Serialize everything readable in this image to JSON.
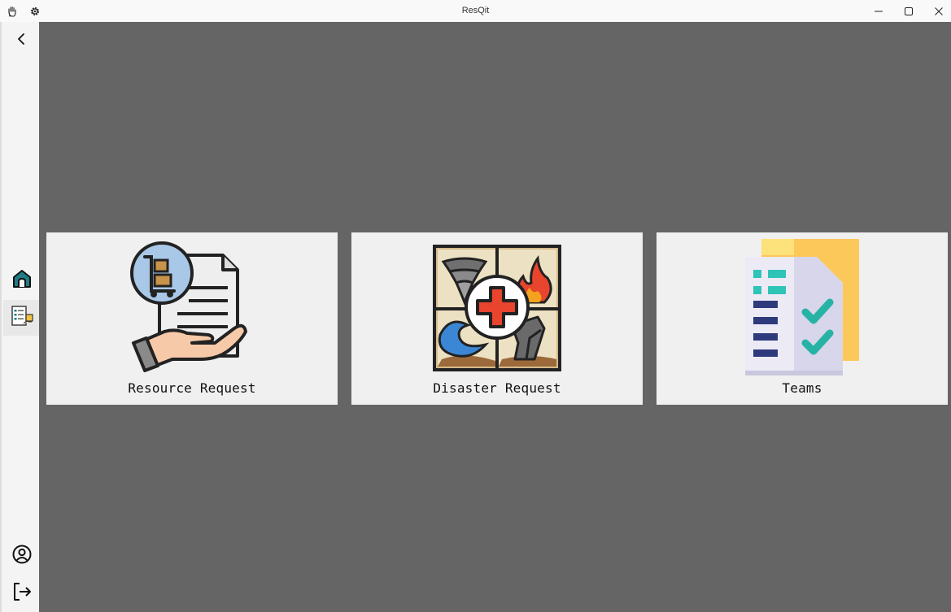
{
  "window": {
    "title": "ResQit",
    "left_icons": [
      "hand-icon",
      "settings-gear-icon"
    ],
    "controls": [
      "minimize-icon",
      "maximize-icon",
      "close-icon"
    ]
  },
  "sidebar": {
    "items": [
      {
        "name": "back",
        "icon": "chevron-left-icon"
      },
      {
        "name": "home",
        "icon": "home-icon",
        "color": "#1e7d86"
      },
      {
        "name": "requests",
        "icon": "document-list-icon",
        "selected": true
      },
      {
        "name": "profile",
        "icon": "user-circle-icon"
      },
      {
        "name": "logout",
        "icon": "logout-arrow-icon"
      }
    ]
  },
  "main": {
    "background": "#656565",
    "cards": [
      {
        "label": "Resource Request",
        "icon": "hand-document-boxes-icon"
      },
      {
        "label": "Disaster Request",
        "icon": "disaster-medical-cross-icon"
      },
      {
        "label": "Teams",
        "icon": "checklist-document-icon"
      }
    ]
  }
}
